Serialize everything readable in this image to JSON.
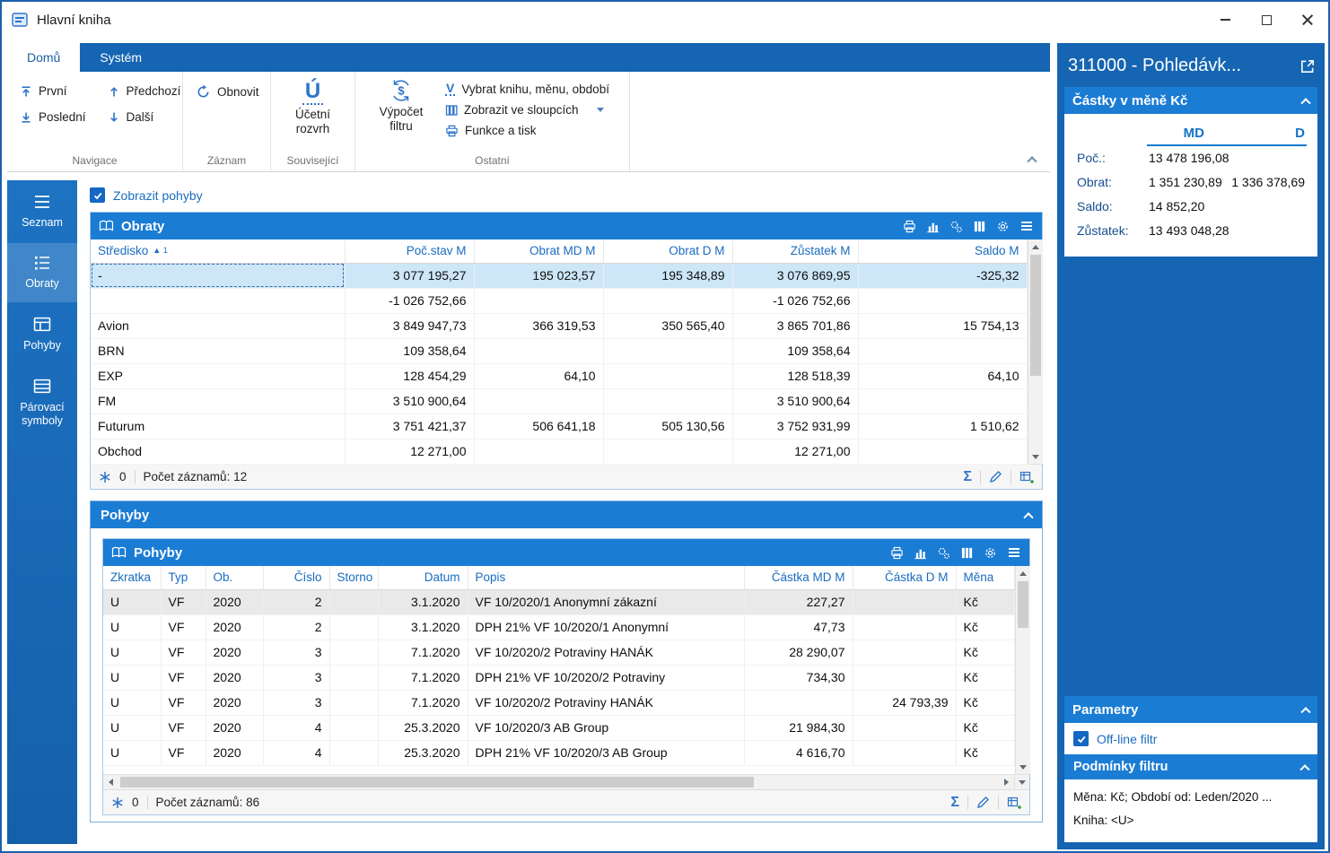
{
  "colors": {
    "accent_blue": "#1b7cd4",
    "panel_dark_blue": "#1565b2",
    "selection_blue": "#cde6f8",
    "link_blue": "#1a6cc0"
  },
  "icons": {
    "sum": "Σ"
  },
  "window": {
    "title": "Hlavní kniha"
  },
  "ribbon": {
    "tabs": [
      {
        "label": "Domů",
        "active": true
      },
      {
        "label": "Systém",
        "active": false
      }
    ],
    "buttons": {
      "first": "První",
      "previous": "Předchozí",
      "last": "Poslední",
      "next": "Další",
      "refresh": "Obnovit",
      "chart_of_accounts": "Účetní rozvrh",
      "filter_calc": "Výpočet filtru",
      "select_book": "Vybrat knihu, měnu, období",
      "show_in_columns": "Zobrazit ve sloupcích",
      "functions_print": "Funkce a tisk"
    },
    "groups": [
      "Navigace",
      "Záznam",
      "Související",
      "Ostatní"
    ]
  },
  "sidebar": {
    "items": [
      {
        "label": "Seznam",
        "active": false
      },
      {
        "label": "Obraty",
        "active": true
      },
      {
        "label": "Pohyby",
        "active": false
      },
      {
        "label": "Párovací symboly",
        "active": false
      }
    ]
  },
  "main": {
    "show_movements": "Zobrazit pohyby",
    "obraty": {
      "title": "Obraty",
      "sort_marker": "▲ 1",
      "columns": [
        "Středisko",
        "Poč.stav M",
        "Obrat MD M",
        "Obrat D M",
        "Zůstatek M",
        "Saldo M"
      ],
      "rows": [
        [
          "-",
          "3 077 195,27",
          "195 023,57",
          "195 348,89",
          "3 076 869,95",
          "-325,32"
        ],
        [
          "",
          "-1 026 752,66",
          "",
          "",
          "-1 026 752,66",
          ""
        ],
        [
          "Avion",
          "3 849 947,73",
          "366 319,53",
          "350 565,40",
          "3 865 701,86",
          "15 754,13"
        ],
        [
          "BRN",
          "109 358,64",
          "",
          "",
          "109 358,64",
          ""
        ],
        [
          "EXP",
          "128 454,29",
          "64,10",
          "",
          "128 518,39",
          "64,10"
        ],
        [
          "FM",
          "3 510 900,64",
          "",
          "",
          "3 510 900,64",
          ""
        ],
        [
          "Futurum",
          "3 751 421,37",
          "506 641,18",
          "505 130,56",
          "3 752 931,99",
          "1 510,62"
        ],
        [
          "Obchod",
          "12 271,00",
          "",
          "",
          "12 271,00",
          ""
        ]
      ],
      "frozen_count": "0",
      "record_count": "Počet záznamů: 12"
    },
    "pohyby_section_title": "Pohyby",
    "pohyby": {
      "title": "Pohyby",
      "columns": [
        "Zkratka",
        "Typ",
        "Ob.",
        "Číslo",
        "Storno",
        "Datum",
        "Popis",
        "Částka MD M",
        "Částka D M",
        "Měna"
      ],
      "rows": [
        [
          "U",
          "VF",
          "2020",
          "2",
          "",
          "3.1.2020",
          "VF 10/2020/1 Anonymní zákazní",
          "227,27",
          "",
          "Kč"
        ],
        [
          "U",
          "VF",
          "2020",
          "2",
          "",
          "3.1.2020",
          "DPH 21% VF 10/2020/1 Anonymní",
          "47,73",
          "",
          "Kč"
        ],
        [
          "U",
          "VF",
          "2020",
          "3",
          "",
          "7.1.2020",
          "VF 10/2020/2 Potraviny HANÁK",
          "28 290,07",
          "",
          "Kč"
        ],
        [
          "U",
          "VF",
          "2020",
          "3",
          "",
          "7.1.2020",
          "DPH 21% VF 10/2020/2 Potraviny",
          "734,30",
          "",
          "Kč"
        ],
        [
          "U",
          "VF",
          "2020",
          "3",
          "",
          "7.1.2020",
          "VF 10/2020/2 Potraviny HANÁK",
          "",
          "24 793,39",
          "Kč"
        ],
        [
          "U",
          "VF",
          "2020",
          "4",
          "",
          "25.3.2020",
          "VF 10/2020/3 AB Group",
          "21 984,30",
          "",
          "Kč"
        ],
        [
          "U",
          "VF",
          "2020",
          "4",
          "",
          "25.3.2020",
          "DPH 21% VF 10/2020/3 AB Group",
          "4 616,70",
          "",
          "Kč"
        ]
      ],
      "frozen_count": "0",
      "record_count": "Počet záznamů: 86"
    }
  },
  "right_panel": {
    "title": "311000 - Pohledávk...",
    "amounts": {
      "title": "Částky v měně Kč",
      "col_md": "MD",
      "col_d": "D",
      "rows": [
        [
          "Poč.:",
          "13 478 196,08",
          ""
        ],
        [
          "Obrat:",
          "1 351 230,89",
          "1 336 378,69"
        ],
        [
          "Saldo:",
          "14 852,20",
          ""
        ],
        [
          "Zůstatek:",
          "13 493 048,28",
          ""
        ]
      ]
    },
    "parameters": {
      "title": "Parametry",
      "offline_filter_label": "Off-line filtr",
      "filter_conditions": {
        "title": "Podmínky filtru",
        "lines": [
          "Měna: Kč; Období od: Leden/2020 ...",
          "Kniha: <U>"
        ]
      }
    }
  }
}
